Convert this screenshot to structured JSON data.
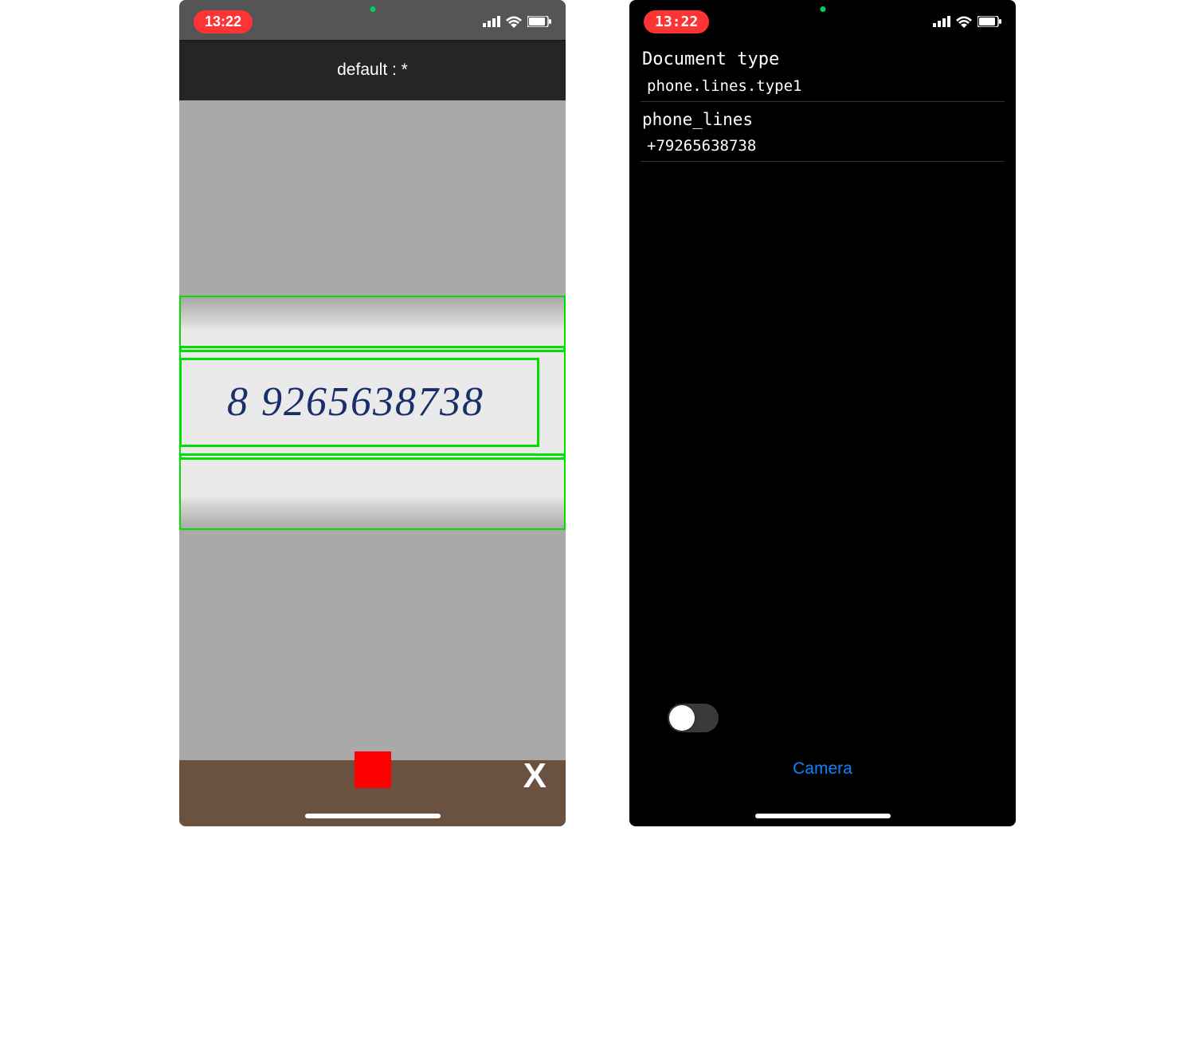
{
  "left": {
    "status_time": "13:22",
    "title": "default : *",
    "handwritten_number": "8 9265638738"
  },
  "right": {
    "status_time": "13:22",
    "section1_title": "Document type",
    "section1_value": "phone.lines.type1",
    "section2_title": "phone_lines",
    "section2_value": "+79265638738",
    "camera_link": "Camera",
    "toggle_on": false
  }
}
